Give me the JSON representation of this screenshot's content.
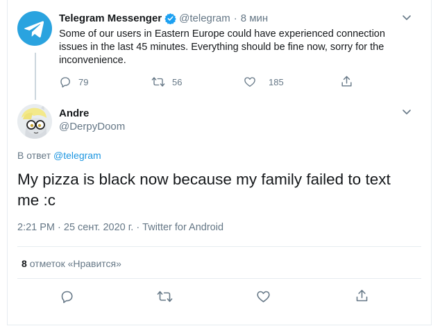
{
  "tweet1": {
    "name": "Telegram Messenger",
    "handle": "@telegram",
    "separator": "·",
    "time": "8 мин",
    "text": "Some of our users in Eastern Europe could have experienced connection issues in the last 45 minutes. Everything should be fine now, sorry for the inconvenience.",
    "replies": "79",
    "retweets": "56",
    "likes": "185"
  },
  "tweet2": {
    "name": "Andre",
    "handle": "@DerpyDoom",
    "reply_prefix": "В ответ",
    "reply_handle": "@telegram",
    "text": "My pizza is black now because my family failed to text me :c",
    "meta": "2:21 PM · 25 сент. 2020 г. · Twitter for Android",
    "likes_count": "8",
    "likes_label": "отметок «Нравится»"
  },
  "colors": {
    "telegram_blue": "#2aa3df",
    "verified_blue": "#1da1f2",
    "link_blue": "#1b95e0",
    "muted_gray": "#657786"
  },
  "icons": [
    "telegram-logo",
    "verified-badge-icon",
    "chevron-down-icon",
    "reply-icon",
    "retweet-icon",
    "like-icon",
    "share-icon"
  ]
}
